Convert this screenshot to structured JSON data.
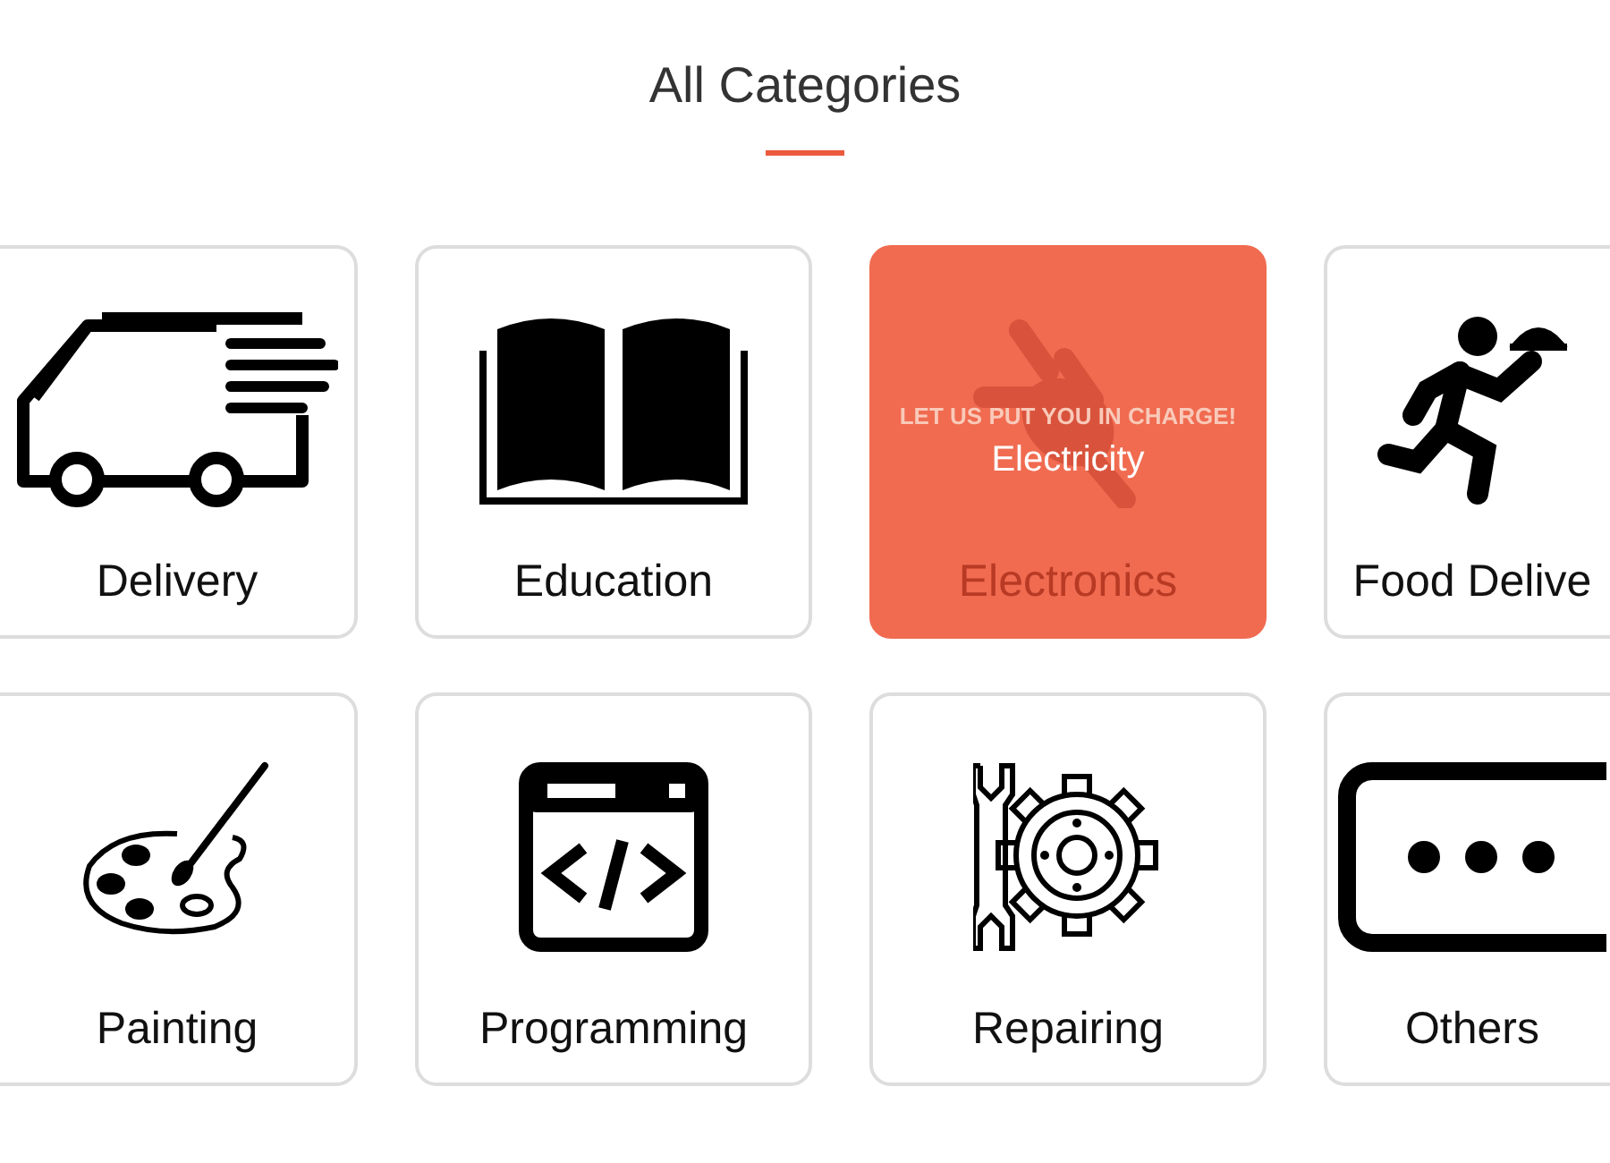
{
  "title": "All Categories",
  "categories": [
    {
      "label": "Delivery",
      "hovered": false
    },
    {
      "label": "Education",
      "hovered": false
    },
    {
      "label": "Electronics",
      "hovered": true,
      "overlay": {
        "tagline": "LET US PUT YOU IN CHARGE!",
        "title": "Electricity"
      }
    },
    {
      "label": "Food Delive",
      "hovered": false
    },
    {
      "label": "Painting",
      "hovered": false
    },
    {
      "label": "Programming",
      "hovered": false
    },
    {
      "label": "Repairing",
      "hovered": false
    },
    {
      "label": "Others",
      "hovered": false
    }
  ]
}
